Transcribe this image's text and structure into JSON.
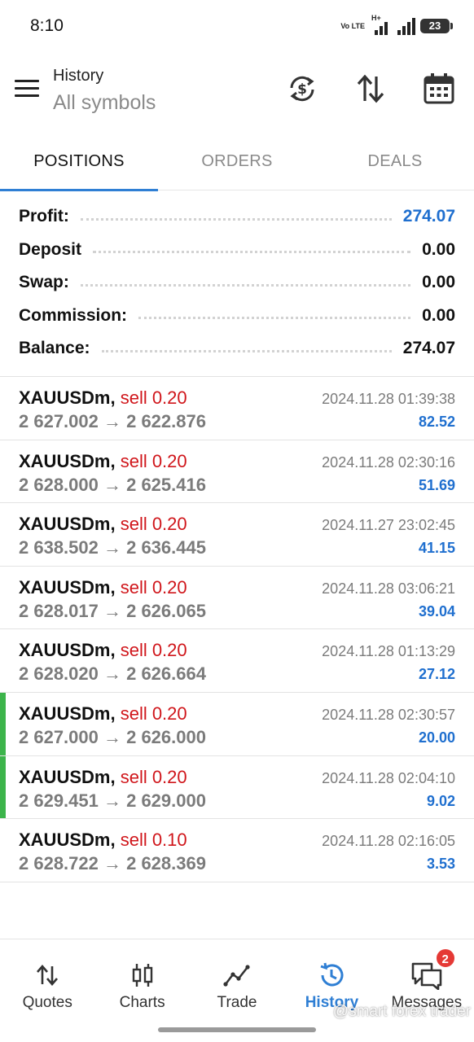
{
  "status_bar": {
    "time": "8:10",
    "volte": "Vo LTE",
    "network": "H+",
    "battery": "23"
  },
  "header": {
    "title": "History",
    "subtitle": "All symbols",
    "icons": [
      "menu-icon",
      "currency-refresh-icon",
      "sort-icon",
      "calendar-icon"
    ]
  },
  "tabs": [
    {
      "label": "POSITIONS",
      "active": true
    },
    {
      "label": "ORDERS",
      "active": false
    },
    {
      "label": "DEALS",
      "active": false
    }
  ],
  "summary": [
    {
      "label": "Profit:",
      "value": "274.07",
      "color": "#1f6fcf"
    },
    {
      "label": "Deposit",
      "value": "0.00"
    },
    {
      "label": "Swap:",
      "value": "0.00"
    },
    {
      "label": "Commission:",
      "value": "0.00"
    },
    {
      "label": "Balance:",
      "value": "274.07"
    }
  ],
  "positions": [
    {
      "symbol": "XAUUSDm,",
      "side": "sell 0.20",
      "prices": "2 627.002 → 2 622.876",
      "time": "2024.11.28 01:39:38",
      "profit": "82.52",
      "marked": false
    },
    {
      "symbol": "XAUUSDm,",
      "side": "sell 0.20",
      "prices": "2 628.000 → 2 625.416",
      "time": "2024.11.28 02:30:16",
      "profit": "51.69",
      "marked": false
    },
    {
      "symbol": "XAUUSDm,",
      "side": "sell 0.20",
      "prices": "2 638.502 → 2 636.445",
      "time": "2024.11.27 23:02:45",
      "profit": "41.15",
      "marked": false
    },
    {
      "symbol": "XAUUSDm,",
      "side": "sell 0.20",
      "prices": "2 628.017 → 2 626.065",
      "time": "2024.11.28 03:06:21",
      "profit": "39.04",
      "marked": false
    },
    {
      "symbol": "XAUUSDm,",
      "side": "sell 0.20",
      "prices": "2 628.020 → 2 626.664",
      "time": "2024.11.28 01:13:29",
      "profit": "27.12",
      "marked": false
    },
    {
      "symbol": "XAUUSDm,",
      "side": "sell 0.20",
      "prices": "2 627.000 → 2 626.000",
      "time": "2024.11.28 02:30:57",
      "profit": "20.00",
      "marked": true
    },
    {
      "symbol": "XAUUSDm,",
      "side": "sell 0.20",
      "prices": "2 629.451 → 2 629.000",
      "time": "2024.11.28 02:04:10",
      "profit": "9.02",
      "marked": true
    },
    {
      "symbol": "XAUUSDm,",
      "side": "sell 0.10",
      "prices": "2 628.722 → 2 628.369",
      "time": "2024.11.28 02:16:05",
      "profit": "3.53",
      "marked": false
    }
  ],
  "bottom_nav": [
    {
      "label": "Quotes",
      "icon": "quotes-icon",
      "active": false
    },
    {
      "label": "Charts",
      "icon": "charts-icon",
      "active": false
    },
    {
      "label": "Trade",
      "icon": "trade-icon",
      "active": false
    },
    {
      "label": "History",
      "icon": "history-icon",
      "active": true
    },
    {
      "label": "Messages",
      "icon": "messages-icon",
      "active": false,
      "badge": "2"
    }
  ],
  "watermark": "@smart forex trader",
  "colors": {
    "accent": "#2f7fd4",
    "profit": "#1f6fcf",
    "sell": "#d0161b",
    "marker": "#3cb44b"
  }
}
